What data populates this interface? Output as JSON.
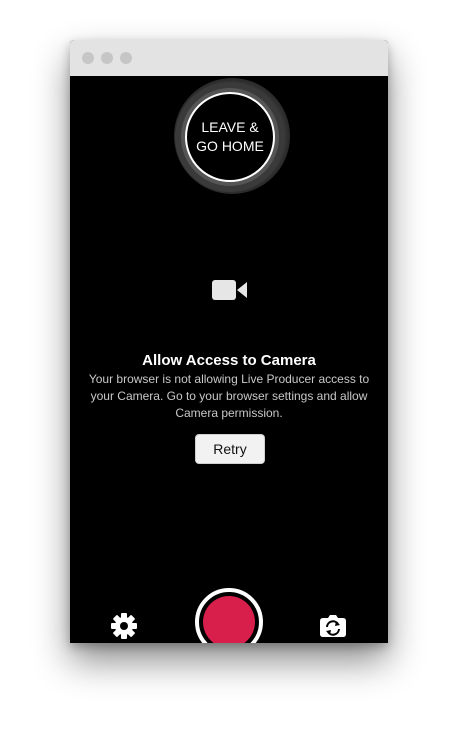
{
  "window": {
    "controls": [
      "close",
      "minimize",
      "maximize"
    ]
  },
  "leave": {
    "line1": "LEAVE &",
    "line2": "GO HOME"
  },
  "camera_notice": {
    "icon": "video-camera-icon",
    "title": "Allow Access to Camera",
    "message": "Your browser is not allowing Live Producer access to your Camera. Go to your browser settings and allow Camera permission.",
    "retry_label": "Retry"
  },
  "controls": {
    "settings_icon": "gear-icon",
    "record_icon": "record-icon",
    "flip_icon": "camera-flip-icon"
  },
  "colors": {
    "record": "#d81e4a",
    "background": "#000000",
    "titlebar": "#e3e3e3"
  }
}
